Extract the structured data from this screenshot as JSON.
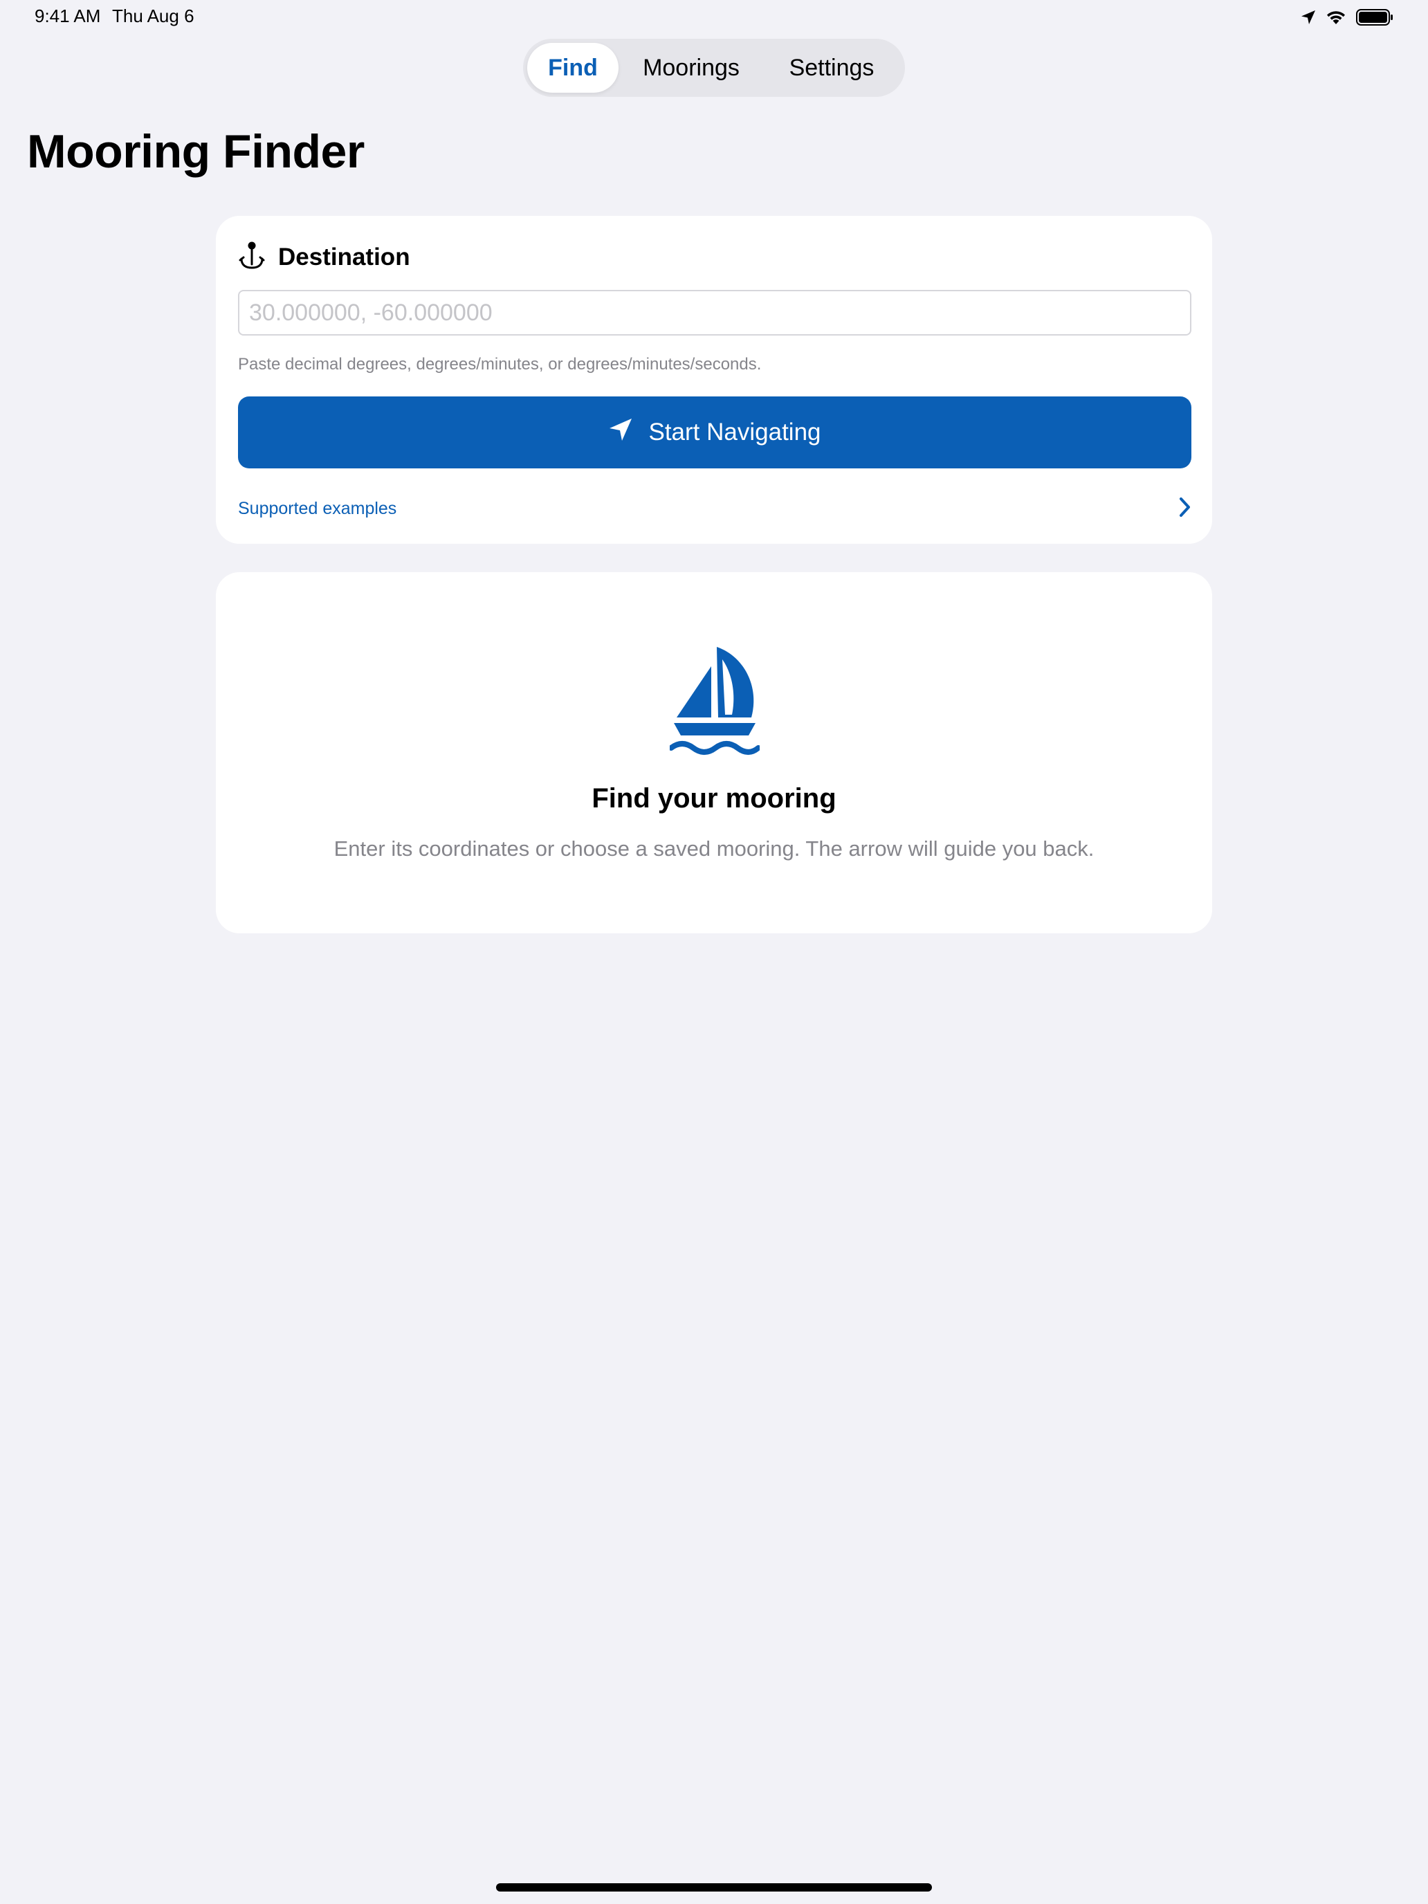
{
  "status_bar": {
    "time": "9:41 AM",
    "date": "Thu Aug 6"
  },
  "tabs": [
    {
      "label": "Find",
      "selected": true
    },
    {
      "label": "Moorings",
      "selected": false
    },
    {
      "label": "Settings",
      "selected": false
    }
  ],
  "title": "Mooring Finder",
  "destination": {
    "label": "Destination",
    "icon": "anchor-pin-icon",
    "input_value": "",
    "input_placeholder": "30.000000, -60.000000",
    "hint": "Paste decimal degrees, degrees/minutes, or degrees/minutes/seconds.",
    "button_label": "Start Navigating",
    "button_icon": "location-arrow-icon",
    "examples_label": "Supported examples"
  },
  "empty_state": {
    "icon": "sailboat-icon",
    "title": "Find your mooring",
    "description": "Enter its coordinates or choose a saved mooring. The arrow will guide you back."
  },
  "colors": {
    "accent": "#0B5FB5",
    "background": "#F2F2F7",
    "card": "#FFFFFF",
    "secondary_text": "#85858B"
  }
}
